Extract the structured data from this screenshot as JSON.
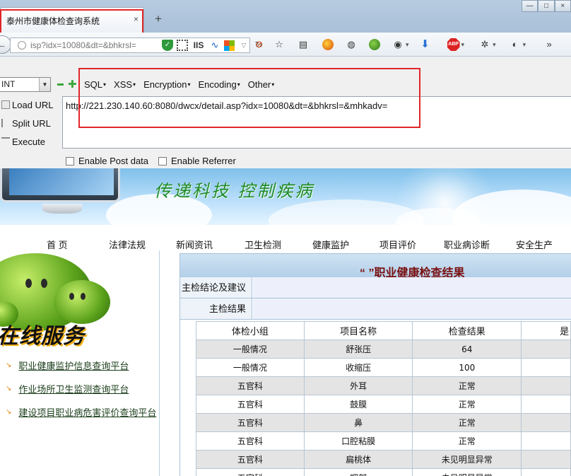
{
  "browser": {
    "tab_title": "泰州市健康体检查询系统",
    "tab_close": "×",
    "new_tab": "+",
    "window_buttons": [
      "—",
      "□",
      "×"
    ],
    "address_text": "isp?idx=10080&dt=&bhkrsl=",
    "iis_label": "IIS",
    "overflow": "»"
  },
  "hackbar": {
    "select_value": "INT",
    "menus": [
      "SQL",
      "XSS",
      "Encryption",
      "Encoding",
      "Other"
    ],
    "actions": [
      "Load URL",
      "Split URL",
      "Execute"
    ],
    "url": "http://221.230.140.60:8080/dwcx/detail.asp?idx=10080&dt=&bhkrsl=&mhkadv=",
    "enable_post": "Enable Post data",
    "enable_referrer": "Enable Referrer"
  },
  "banner": {
    "slogan": "传递科技  控制疾病"
  },
  "site_nav": [
    "首 页",
    "法律法规",
    "新闻资讯",
    "卫生检测",
    "健康监护",
    "项目评价",
    "职业病诊断",
    "安全生产"
  ],
  "left": {
    "title": "在线服务",
    "links": [
      "职业健康监护信息查询平台",
      "作业场所卫生监测查询平台",
      "建设项目职业病危害评价查询平台"
    ]
  },
  "result": {
    "title": "“ ”职业健康检查结果",
    "rows": [
      {
        "label": "主检结论及建议",
        "value": ""
      },
      {
        "label": "主检结果",
        "value": ""
      }
    ],
    "table": {
      "headers": [
        "体检小组",
        "项目名称",
        "检查结果",
        "是"
      ],
      "rows": [
        [
          "一般情况",
          "舒张压",
          "64",
          ""
        ],
        [
          "一般情况",
          "收缩压",
          "100",
          ""
        ],
        [
          "五官科",
          "外耳",
          "正常",
          ""
        ],
        [
          "五官科",
          "鼓膜",
          "正常",
          ""
        ],
        [
          "五官科",
          "鼻",
          "正常",
          ""
        ],
        [
          "五官科",
          "口腔粘膜",
          "正常",
          ""
        ],
        [
          "五官科",
          "扁桃体",
          "未见明显异常",
          ""
        ],
        [
          "五官科",
          "咽部",
          "未见明显异常",
          ""
        ]
      ]
    }
  },
  "colors": {
    "highlight": "#e0262a",
    "result_title": "#7a1010",
    "slogan": "#1f8a2a"
  }
}
